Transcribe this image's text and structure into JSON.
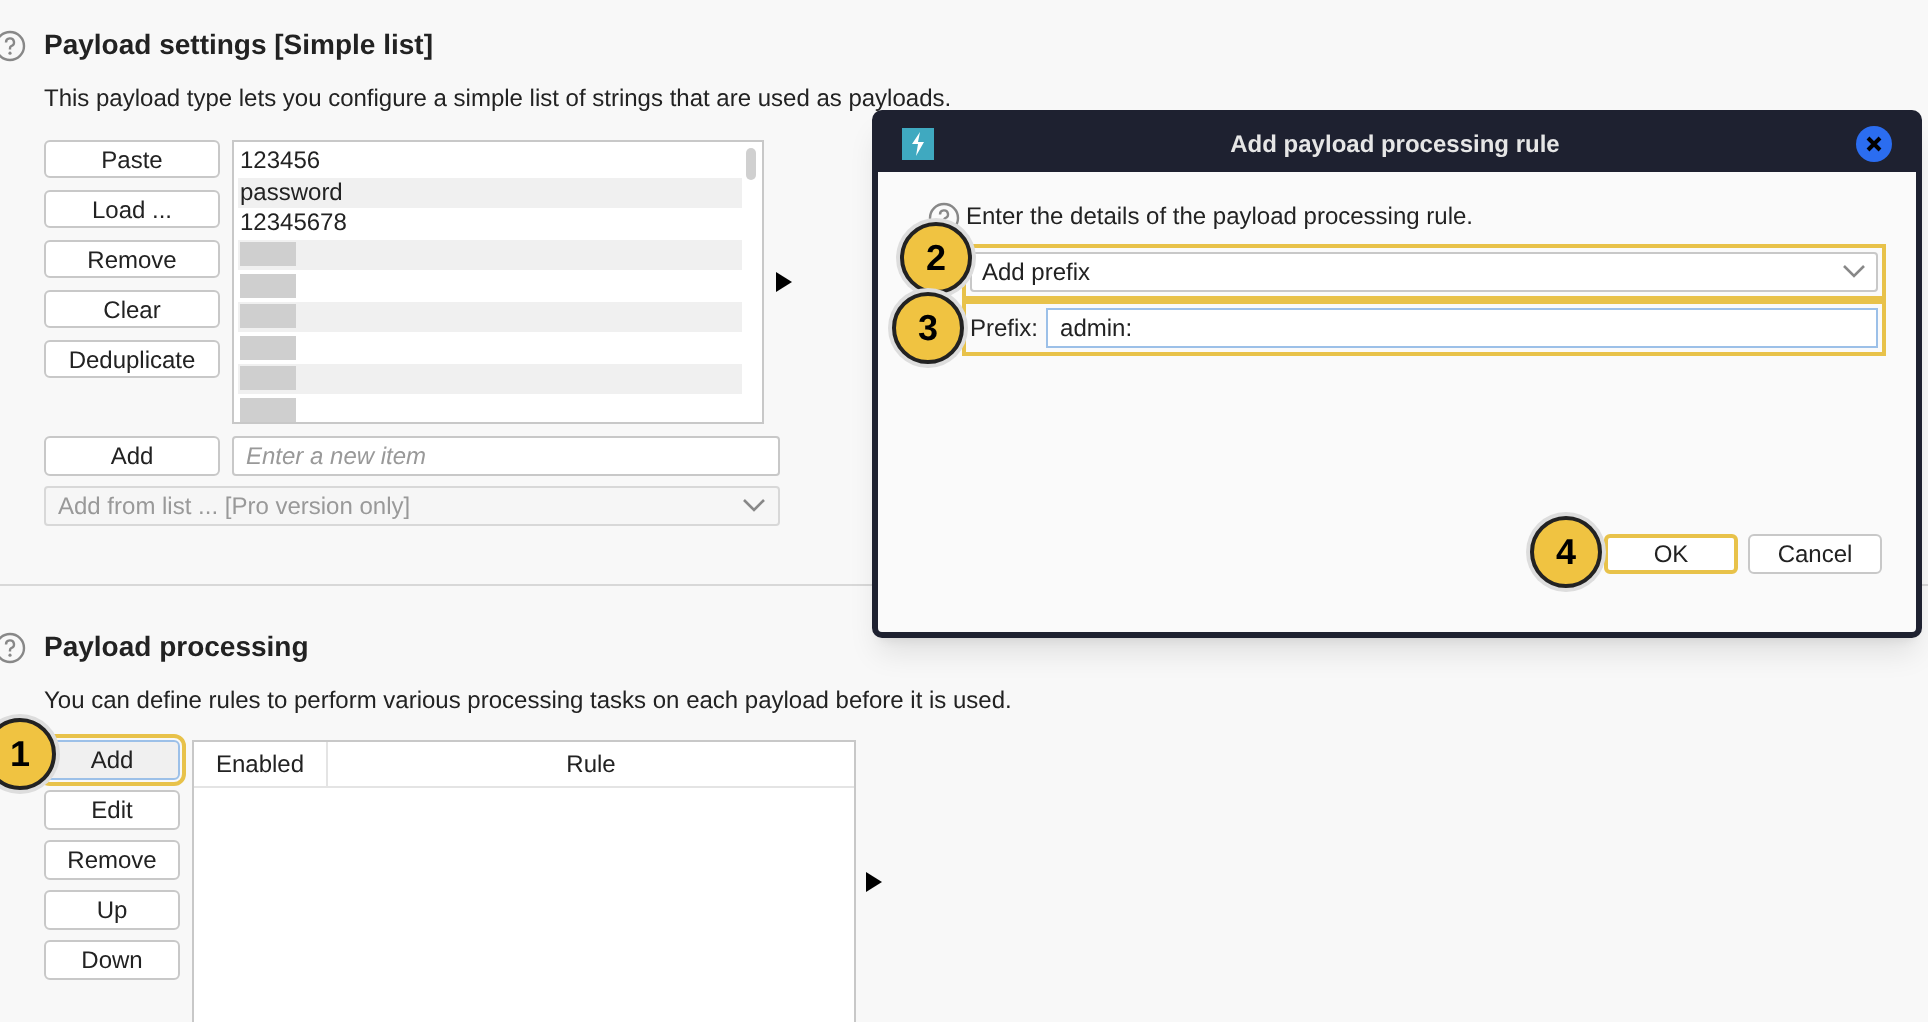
{
  "payload_settings": {
    "title": "Payload settings [Simple list]",
    "description": "This payload type lets you configure a simple list of strings that are used as payloads.",
    "buttons": [
      "Paste",
      "Load ...",
      "Remove",
      "Clear",
      "Deduplicate"
    ],
    "items": [
      {
        "kind": "text",
        "text": "123456"
      },
      {
        "kind": "text",
        "text": "password"
      },
      {
        "kind": "text",
        "text": "12345678"
      },
      {
        "kind": "redacted"
      },
      {
        "kind": "redacted"
      },
      {
        "kind": "redacted"
      },
      {
        "kind": "redacted"
      },
      {
        "kind": "redacted"
      },
      {
        "kind": "redacted"
      }
    ],
    "add_button": "Add",
    "new_item": {
      "placeholder": "Enter a new item"
    },
    "add_from_list": {
      "value": "Add from list ... [Pro version only]",
      "disabled": true
    }
  },
  "payload_processing": {
    "title": "Payload processing",
    "description": "You can define rules to perform various processing tasks on each payload before it is used.",
    "buttons": [
      {
        "label": "Add",
        "callout": "1"
      },
      {
        "label": "Edit"
      },
      {
        "label": "Remove"
      },
      {
        "label": "Up"
      },
      {
        "label": "Down"
      }
    ],
    "table": {
      "columns": [
        "Enabled",
        "Rule"
      ]
    }
  },
  "dialog": {
    "title": "Add payload processing rule",
    "instruction": "Enter the details of the payload processing rule.",
    "rule_type": {
      "value": "Add prefix",
      "callout": "2"
    },
    "prefix_field": {
      "label": "Prefix:",
      "value": "admin:",
      "callout": "3"
    },
    "buttons": [
      {
        "label": "OK",
        "callout": "4"
      },
      {
        "label": "Cancel"
      }
    ]
  }
}
